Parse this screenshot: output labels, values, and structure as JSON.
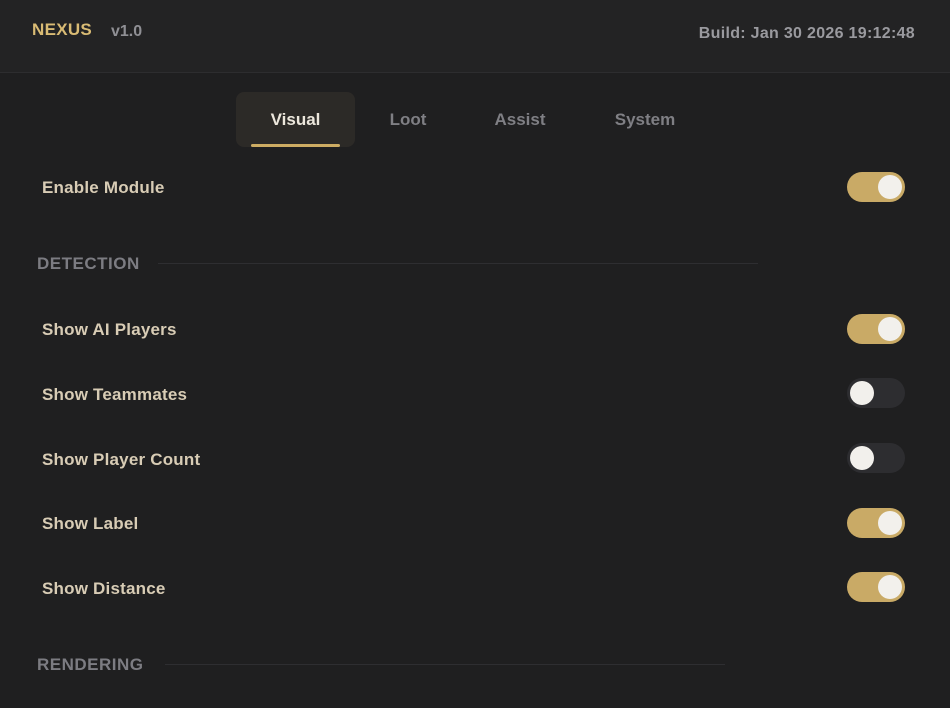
{
  "header": {
    "brand": "NEXUS",
    "version": "v1.0",
    "build": "Build: Jan 30 2026 19:12:48"
  },
  "tabs": [
    {
      "label": "Visual",
      "active": true
    },
    {
      "label": "Loot",
      "active": false
    },
    {
      "label": "Assist",
      "active": false
    },
    {
      "label": "System",
      "active": false
    }
  ],
  "enable_module": {
    "label": "Enable Module",
    "enabled": true
  },
  "sections": {
    "detection": "DETECTION",
    "rendering": "RENDERING"
  },
  "detection_options": [
    {
      "label": "Show AI Players",
      "enabled": true
    },
    {
      "label": "Show Teammates",
      "enabled": false
    },
    {
      "label": "Show Player Count",
      "enabled": false
    },
    {
      "label": "Show Label",
      "enabled": true
    },
    {
      "label": "Show Distance",
      "enabled": true
    }
  ],
  "colors": {
    "accent": "#c9aa66",
    "brand": "#d9bb74",
    "toggle_off": "#2d2d30",
    "background": "#1f1f20"
  }
}
